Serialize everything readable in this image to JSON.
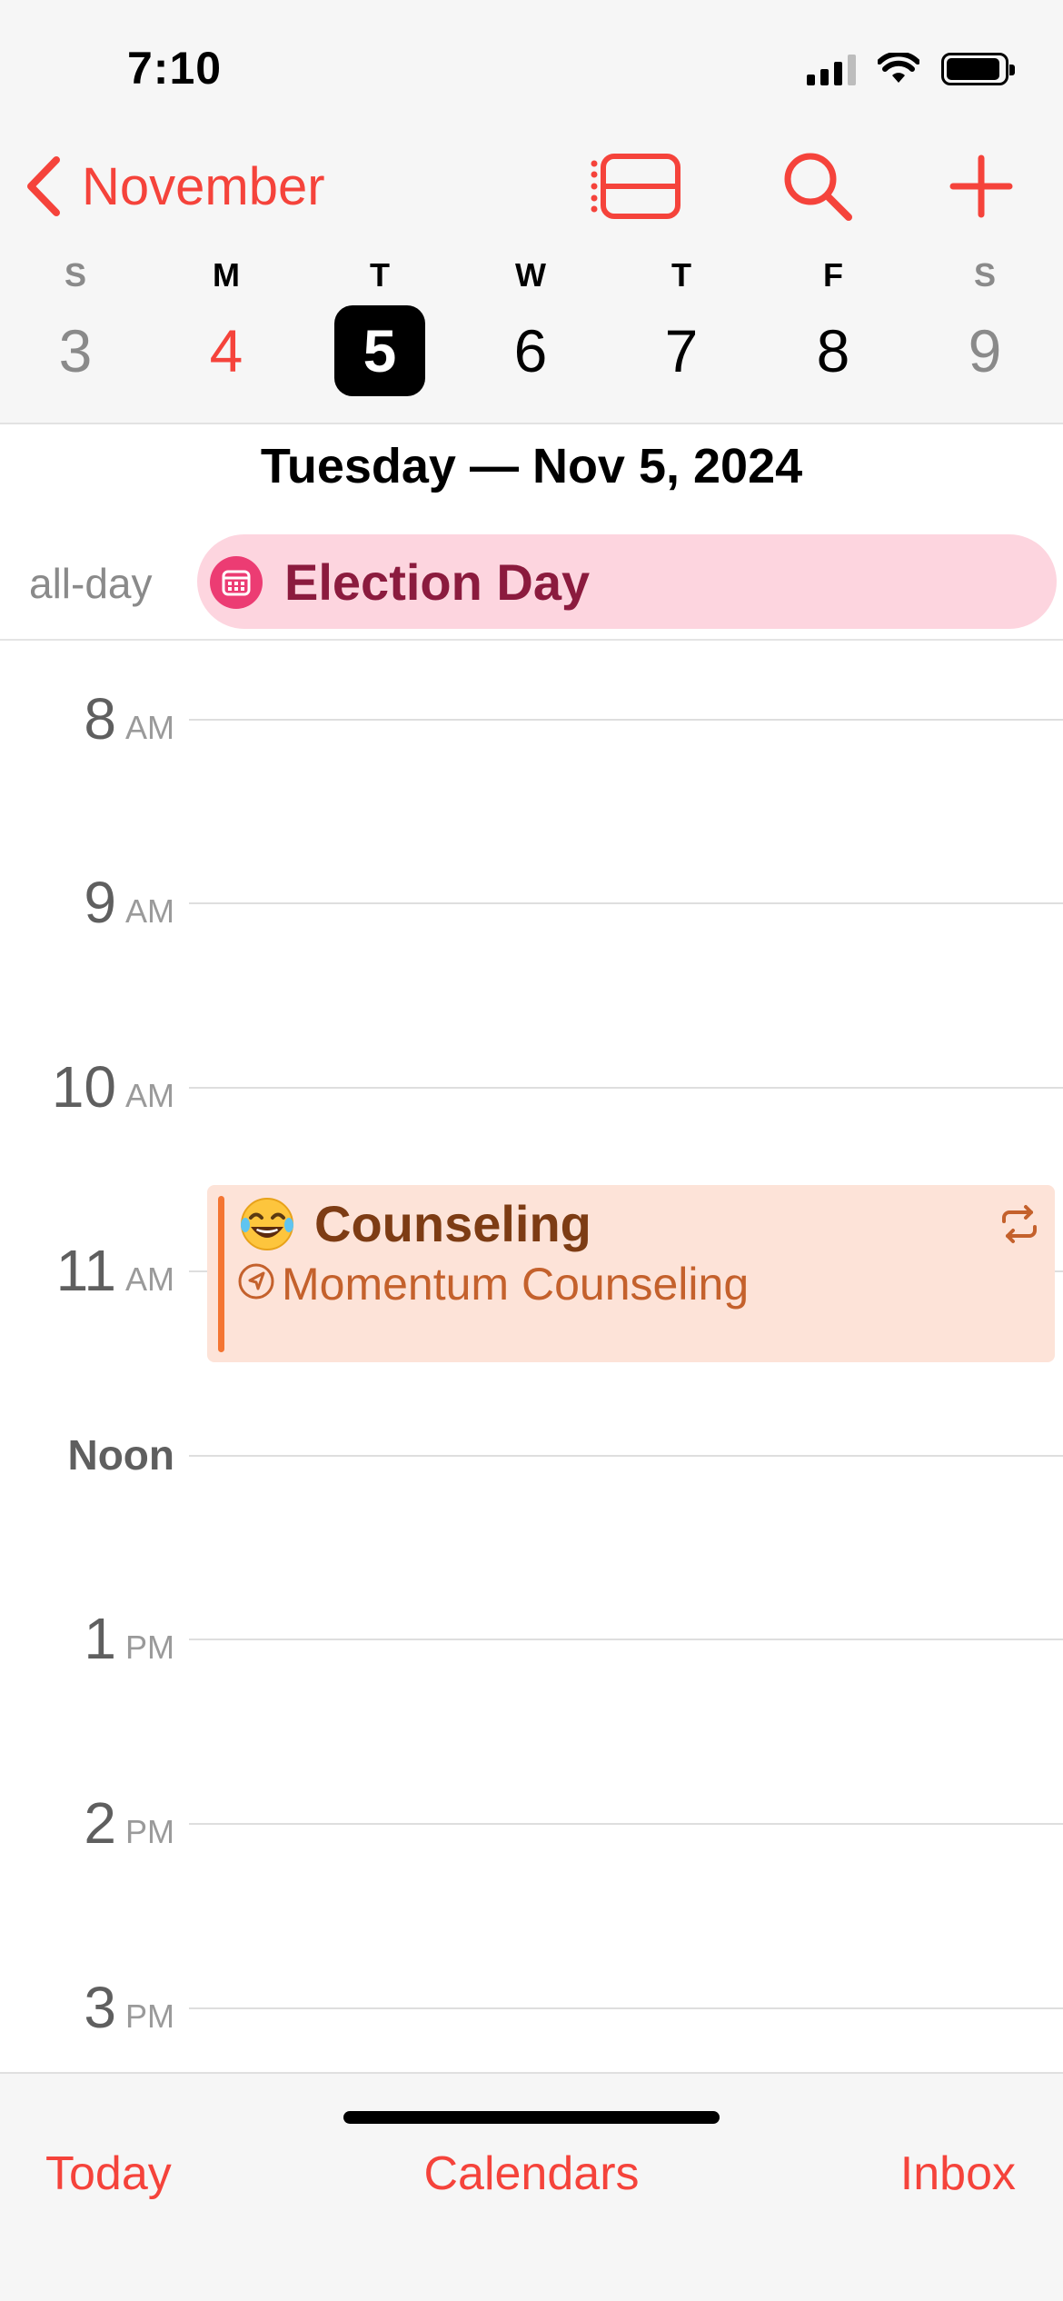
{
  "status_bar": {
    "time": "7:10",
    "icons": [
      "cellular-signal-icon",
      "wifi-icon",
      "battery-icon"
    ]
  },
  "nav": {
    "back_label": "November",
    "icons": [
      "chevron-left-icon",
      "list-view-icon",
      "search-icon",
      "plus-icon"
    ]
  },
  "week": {
    "days": [
      {
        "letter": "S",
        "num": "3"
      },
      {
        "letter": "M",
        "num": "4"
      },
      {
        "letter": "T",
        "num": "5"
      },
      {
        "letter": "W",
        "num": "6"
      },
      {
        "letter": "T",
        "num": "7"
      },
      {
        "letter": "F",
        "num": "8"
      },
      {
        "letter": "S",
        "num": "9"
      }
    ],
    "selected_index": 2,
    "today_index": 1
  },
  "date_heading": "Tuesday — Nov 5, 2024",
  "all_day": {
    "label": "all-day",
    "event_title": "Election Day",
    "event_icon": "calendar-icon"
  },
  "timeline": {
    "hours": [
      {
        "num": "8",
        "ampm": "AM"
      },
      {
        "num": "9",
        "ampm": "AM"
      },
      {
        "num": "10",
        "ampm": "AM"
      },
      {
        "num": "11",
        "ampm": "AM"
      },
      {
        "num": "Noon",
        "ampm": ""
      },
      {
        "num": "1",
        "ampm": "PM"
      },
      {
        "num": "2",
        "ampm": "PM"
      },
      {
        "num": "3",
        "ampm": "PM"
      }
    ]
  },
  "event": {
    "emoji": "😂",
    "title": "Counseling",
    "location": "Momentum Counseling",
    "repeat_icon": "repeat-icon",
    "location_icon": "location-arrow-icon"
  },
  "toolbar": {
    "today": "Today",
    "calendars": "Calendars",
    "inbox": "Inbox"
  },
  "colors": {
    "accent": "#f5433b",
    "allday_bg": "#fdd5df",
    "allday_text": "#8b1b3e",
    "event_bg": "#fde3d8",
    "event_bar": "#f47532",
    "event_title": "#7d3c14",
    "event_location": "#c4612c"
  }
}
